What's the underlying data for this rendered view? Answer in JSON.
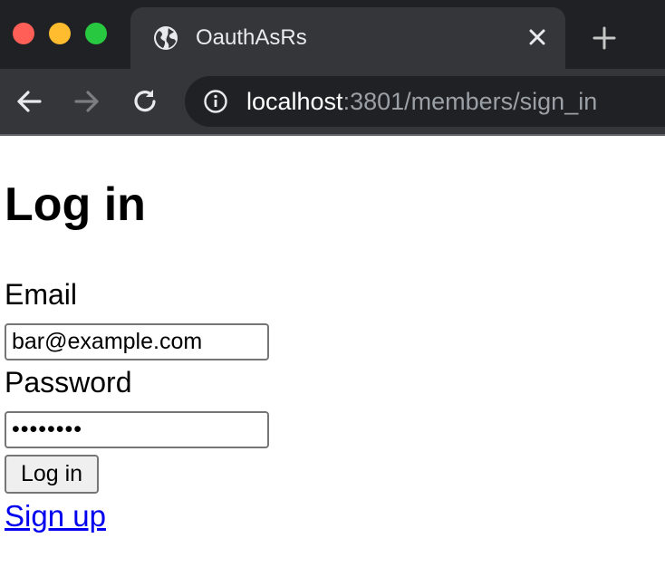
{
  "browser": {
    "tab": {
      "title": "OauthAsRs",
      "favicon": "globe-icon"
    },
    "new_tab_icon": "plus-icon",
    "toolbar": {
      "back_icon": "arrow-left-icon",
      "forward_icon": "arrow-right-icon",
      "reload_icon": "reload-icon"
    },
    "address_bar": {
      "info_icon": "info-icon",
      "host": "localhost",
      "path": ":3801/members/sign_in"
    },
    "colors": {
      "tabstrip": "#202124",
      "toolbar": "#35363a",
      "close_red": "#ff5f57",
      "minimize_yellow": "#febc2e",
      "maximize_green": "#28c840"
    }
  },
  "page": {
    "title": "Log in",
    "form": {
      "email_label": "Email",
      "email_value": "bar@example.com",
      "password_label": "Password",
      "password_value": "••••••••",
      "submit_label": "Log in"
    },
    "links": {
      "sign_up": "Sign up"
    },
    "colors": {
      "link": "#0000ee"
    }
  }
}
